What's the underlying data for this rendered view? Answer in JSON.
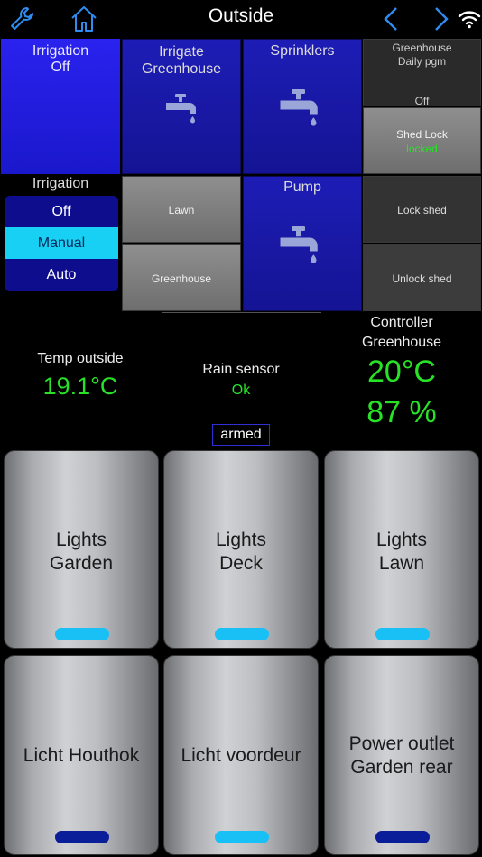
{
  "header": {
    "title": "Outside",
    "left_icons": [
      "wrench-icon",
      "home-icon"
    ],
    "right_icons": [
      "chevron-left-icon",
      "chevron-right-icon",
      "wifi-icon"
    ]
  },
  "tiles": {
    "irrigation_status": {
      "label": "Irrigation",
      "value": "Off"
    },
    "irrigate_greenhouse": {
      "label": "Irrigate\nGreenhouse",
      "icon": "faucet-icon"
    },
    "sprinklers": {
      "label": "Sprinklers",
      "icon": "faucet-icon"
    },
    "greenhouse_daily": {
      "label": "Greenhouse\nDaily pgm",
      "value": "Off"
    },
    "shed_lock": {
      "label": "Shed Lock",
      "value": "locked"
    },
    "irrigation_mode": {
      "label": "Irrigation",
      "options": [
        "Off",
        "Manual",
        "Auto"
      ],
      "selected": "Manual"
    },
    "lawn": {
      "label": "Lawn"
    },
    "greenhouse": {
      "label": "Greenhouse"
    },
    "pump": {
      "label": "Pump",
      "icon": "faucet-icon"
    },
    "lock_shed": {
      "label": "Lock shed"
    },
    "unlock_shed": {
      "label": "Unlock shed"
    }
  },
  "sensors": {
    "temp_outside": {
      "label": "Temp outside",
      "value": "19.1°C"
    },
    "rain_sensor": {
      "label": "Rain sensor",
      "value": "Ok"
    },
    "controller": {
      "label": "Controller\nGreenhouse",
      "temp": "20°C",
      "humidity": "87 %"
    },
    "armed": "armed"
  },
  "buttons": [
    {
      "label": "Lights\nGarden",
      "state": "on"
    },
    {
      "label": "Lights\nDeck",
      "state": "on"
    },
    {
      "label": "Lights\nLawn",
      "state": "on"
    },
    {
      "label": "Licht Houthok",
      "state": "off"
    },
    {
      "label": "Licht voordeur",
      "state": "on"
    },
    {
      "label": "Power outlet\nGarden rear",
      "state": "off"
    }
  ],
  "colors": {
    "accent_blue": "#1a18cc",
    "green_value": "#27e227",
    "indicator_on": "#19c0f5",
    "indicator_off": "#0b1e9a"
  }
}
